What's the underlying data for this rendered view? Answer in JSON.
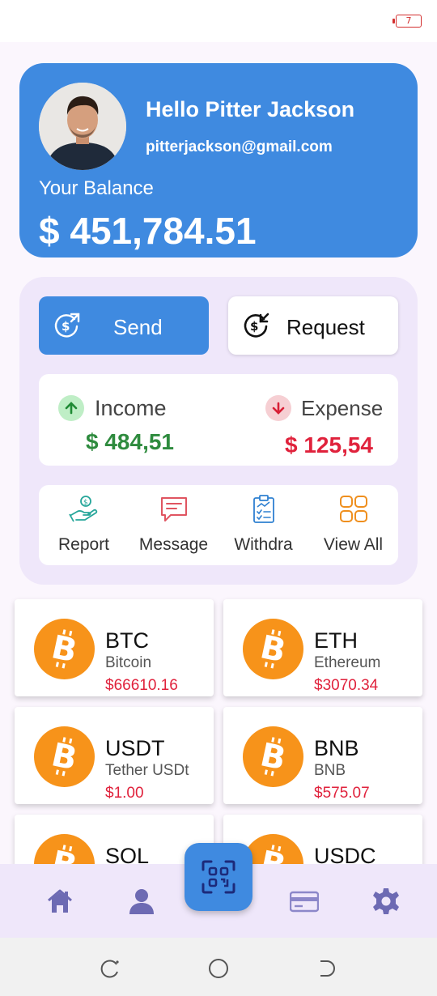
{
  "status_bar": {
    "battery_level": "7"
  },
  "profile": {
    "greeting": "Hello Pitter Jackson",
    "email": "pitterjackson@gmail.com",
    "balance_label": "Your Balance",
    "balance_value": "$ 451,784.51"
  },
  "actions": {
    "send_label": "Send",
    "request_label": "Request"
  },
  "summary": {
    "income_label": "Income",
    "income_value": "$ 484,51",
    "expense_label": "Expense",
    "expense_value": "$ 125,54"
  },
  "quick_actions": [
    {
      "label": "Report",
      "icon": "hand-money-icon"
    },
    {
      "label": "Message",
      "icon": "message-icon"
    },
    {
      "label": "Withdra",
      "icon": "clipboard-chart-icon"
    },
    {
      "label": "View All",
      "icon": "grid-icon"
    }
  ],
  "coins": [
    {
      "symbol": "BTC",
      "name": "Bitcoin",
      "price": "$66610.16"
    },
    {
      "symbol": "ETH",
      "name": "Ethereum",
      "price": "$3070.34"
    },
    {
      "symbol": "USDT",
      "name": "Tether USDt",
      "price": "$1.00"
    },
    {
      "symbol": "BNB",
      "name": "BNB",
      "price": "$575.07"
    },
    {
      "symbol": "SOL",
      "name": "",
      "price": ""
    },
    {
      "symbol": "USDC",
      "name": "",
      "price": ""
    }
  ],
  "bottom_nav": [
    "home-icon",
    "user-icon",
    "qr-scan-icon",
    "card-icon",
    "settings-icon"
  ],
  "colors": {
    "primary": "#3f8ae0",
    "income": "#2e8b3e",
    "expense": "#e0223c",
    "panel": "#efe7fa",
    "coin": "#f7931a"
  }
}
